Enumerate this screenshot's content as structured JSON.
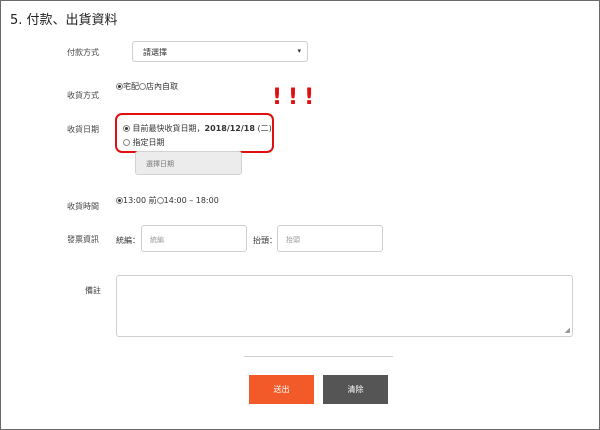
{
  "section_title": "5. 付款、出貨資料",
  "payment": {
    "label": "付款方式",
    "selected": "請選擇",
    "caret": "▾"
  },
  "shipping_method": {
    "label": "收貨方式",
    "options": [
      {
        "label": "宅配",
        "checked": true
      },
      {
        "label": "店內自取",
        "checked": false
      }
    ]
  },
  "delivery_date": {
    "label": "收貨日期",
    "earliest_prefix": "目前最快收貨日期，",
    "earliest_date": "2018/12/18",
    "earliest_weekday": " (二)",
    "specify_label": "指定日期",
    "choose_button": "選擇日期",
    "annotation": "!!!",
    "annotation_color": "#e01010"
  },
  "delivery_time": {
    "label": "收貨時間",
    "options": [
      {
        "label": "13:00 前",
        "checked": true
      },
      {
        "label": "14:00 – 18:00",
        "checked": false
      }
    ]
  },
  "invoice": {
    "label": "發票資訊",
    "tax_id_label": "統編：",
    "tax_id_placeholder": "統編",
    "title_label": "抬頭：",
    "title_placeholder": "抬頭"
  },
  "notes": {
    "label": "備註",
    "value": ""
  },
  "buttons": {
    "submit": "送出",
    "submit_color": "#f25a29",
    "clear": "清除",
    "clear_color": "#555555"
  }
}
